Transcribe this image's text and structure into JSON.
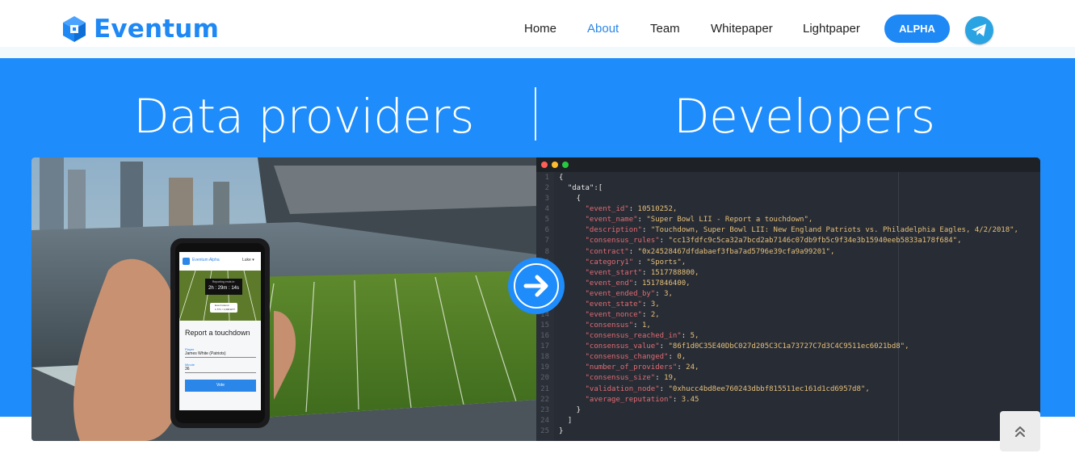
{
  "header": {
    "brand": "Eventum",
    "nav": [
      {
        "label": "Home",
        "active": false
      },
      {
        "label": "About",
        "active": true
      },
      {
        "label": "Team",
        "active": false
      },
      {
        "label": "Whitepaper",
        "active": false
      },
      {
        "label": "Lightpaper",
        "active": false
      }
    ],
    "alpha_label": "ALPHA",
    "social_icon": "telegram-icon",
    "colors": {
      "brand": "#1e88f5",
      "active_nav": "#2a86e8"
    }
  },
  "hero": {
    "left_title": "Data providers",
    "right_title": "Developers",
    "background": "#1e8cfa",
    "arrow_icon": "arrow-right-icon"
  },
  "phone": {
    "brand": "Eventum Alpha",
    "user": "Luke ▾",
    "timer_label": "Reporting ends in:",
    "timer": "2h : 29m : 14s",
    "coin_label": "Event tokens:",
    "coin_value": "1,771 ≈ 1,000 EVT",
    "question": "Report a touchdown",
    "player_label": "Player",
    "player_value": "James White (Patriots)",
    "minute_label": "Minute",
    "minute_value": "36",
    "vote_label": "Vote"
  },
  "code": {
    "lines": [
      {
        "n": "1",
        "t": "{"
      },
      {
        "n": "2",
        "t": "  \"data\":["
      },
      {
        "n": "3",
        "t": "    {"
      },
      {
        "n": "4",
        "k": "\"event_id\"",
        "v": "10510252,"
      },
      {
        "n": "5",
        "k": "\"event_name\"",
        "v": "\"Super Bowl LII - Report a touchdown\","
      },
      {
        "n": "6",
        "k": "\"description\"",
        "v": "\"Touchdown, Super Bowl LII: New England Patriots vs. Philadelphia Eagles, 4/2/2018\","
      },
      {
        "n": "7",
        "k": "\"consensus_rules\"",
        "v": "\"cc13fdfc9c5ca32a7bcd2ab7146c07db9fb5c9f34e3b15940eeb5833a178f684\","
      },
      {
        "n": "8",
        "k": "\"contract\"",
        "v": "\"0x24528467dfdabaef3fba7ad5796e39cfa9a99201\","
      },
      {
        "n": "9",
        "k": "\"category1\" ",
        "v": "\"Sports\","
      },
      {
        "n": "10",
        "k": "\"event_start\"",
        "v": "1517788800,"
      },
      {
        "n": "11",
        "k": "\"event_end\"",
        "v": "1517846400,"
      },
      {
        "n": "12",
        "k": "\"event_ended_by\"",
        "v": "3,"
      },
      {
        "n": "13",
        "k": "\"event_state\"",
        "v": "3,"
      },
      {
        "n": "14",
        "k": "\"event_nonce\"",
        "v": "2,"
      },
      {
        "n": "15",
        "k": "\"consensus\"",
        "v": "1,"
      },
      {
        "n": "16",
        "k": "\"consensus_reached_in\"",
        "v": "5,"
      },
      {
        "n": "17",
        "k": "\"consensus_value\"",
        "v": "\"86f1d0C35E40DbC027d205C3C1a73727C7d3C4C9511ec6021bd8\","
      },
      {
        "n": "18",
        "k": "\"consensus_changed\"",
        "v": "0,"
      },
      {
        "n": "19",
        "k": "\"number_of_providers\"",
        "v": "24,"
      },
      {
        "n": "20",
        "k": "\"consensus_size\"",
        "v": "19,"
      },
      {
        "n": "21",
        "k": "\"validation_node\"",
        "v": "\"0xhucc4bd8ee760243dbbf815511ec161d1cd6957d8\","
      },
      {
        "n": "22",
        "k": "\"average_reputation\"",
        "v": "3.45"
      },
      {
        "n": "23",
        "t": "    }"
      },
      {
        "n": "24",
        "t": "  ]"
      },
      {
        "n": "25",
        "t": "}"
      }
    ],
    "window_dots": [
      "#ff5f56",
      "#ffbd2e",
      "#27c93f"
    ]
  },
  "scroll_top_icon": "double-chevron-up-icon"
}
